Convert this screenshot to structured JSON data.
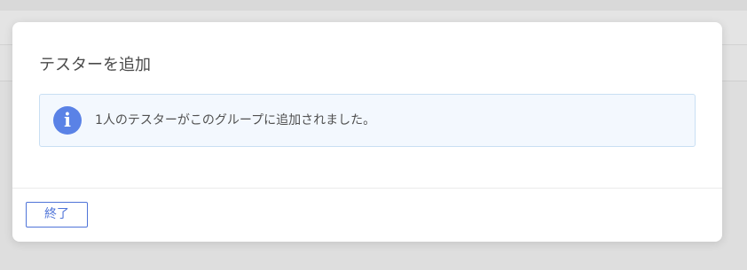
{
  "dialog": {
    "title": "テスターを追加",
    "info": {
      "icon": "info-icon",
      "glyph": "i",
      "message": "1人のテスターがこのグループに追加されました。",
      "accent_color": "#5a82e6"
    },
    "close_label": "終了",
    "button_color": "#4f74d8"
  }
}
